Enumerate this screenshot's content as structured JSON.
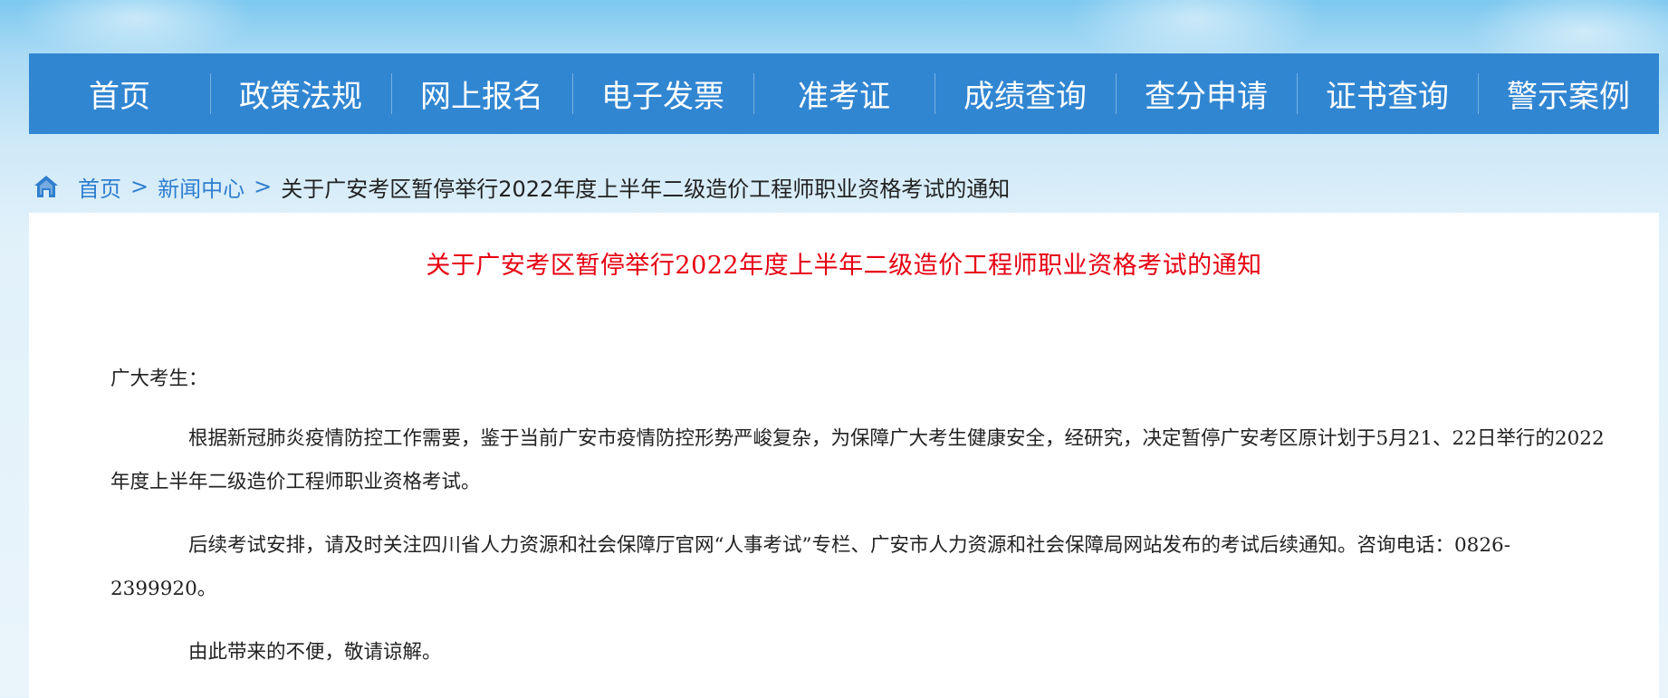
{
  "nav": {
    "items": [
      {
        "label": "首页"
      },
      {
        "label": "政策法规"
      },
      {
        "label": "网上报名"
      },
      {
        "label": "电子发票"
      },
      {
        "label": "准考证"
      },
      {
        "label": "成绩查询"
      },
      {
        "label": "查分申请"
      },
      {
        "label": "证书查询"
      },
      {
        "label": "警示案例"
      }
    ]
  },
  "breadcrumb": {
    "home": "首页",
    "separator": ">",
    "section": "新闻中心",
    "current": "关于广安考区暂停举行2022年度上半年二级造价工程师职业资格考试的通知"
  },
  "article": {
    "title": "关于广安考区暂停举行2022年度上半年二级造价工程师职业资格考试的通知",
    "salutation": "广大考生：",
    "paragraphs": [
      "根据新冠肺炎疫情防控工作需要，鉴于当前广安市疫情防控形势严峻复杂，为保障广大考生健康安全，经研究，决定暂停广安考区原计划于5月21、22日举行的2022年度上半年二级造价工程师职业资格考试。",
      "后续考试安排，请及时关注四川省人力资源和社会保障厅官网“人事考试”专栏、广安市人力资源和社会保障局网站发布的考试后续通知。咨询电话：0826-2399920。",
      "由此带来的不便，敬请谅解。"
    ]
  },
  "colors": {
    "nav_bg": "#3186d2",
    "title_red": "#e60012",
    "link_blue": "#2f7fd0"
  },
  "icons": {
    "breadcrumb_home": "home-icon"
  }
}
